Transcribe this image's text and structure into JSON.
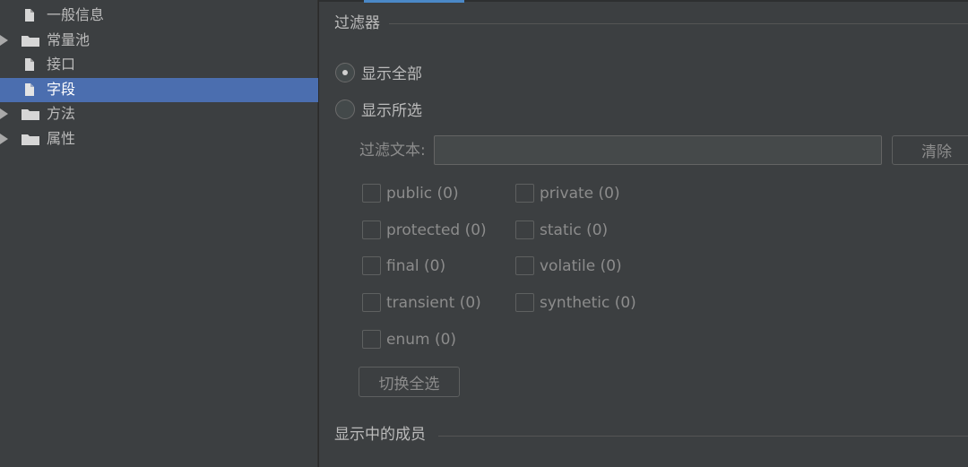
{
  "tree": {
    "items": [
      {
        "label": "一般信息",
        "icon": "file-icon",
        "expandable": false,
        "selected": false
      },
      {
        "label": "常量池",
        "icon": "folder-icon",
        "expandable": true,
        "selected": false
      },
      {
        "label": "接口",
        "icon": "file-icon",
        "expandable": false,
        "selected": false
      },
      {
        "label": "字段",
        "icon": "file-icon",
        "expandable": false,
        "selected": true
      },
      {
        "label": "方法",
        "icon": "folder-icon",
        "expandable": true,
        "selected": false
      },
      {
        "label": "属性",
        "icon": "folder-icon",
        "expandable": true,
        "selected": false
      }
    ]
  },
  "filter": {
    "title": "过滤器",
    "radio_all": "显示全部",
    "radio_selected": "显示所选",
    "radio_checked": "all",
    "text_label": "过滤文本:",
    "text_value": "",
    "clear_button": "清除",
    "checkboxes": [
      {
        "label": "public (0)",
        "checked": false
      },
      {
        "label": "private (0)",
        "checked": false
      },
      {
        "label": "protected (0)",
        "checked": false
      },
      {
        "label": "static (0)",
        "checked": false
      },
      {
        "label": "final (0)",
        "checked": false
      },
      {
        "label": "volatile (0)",
        "checked": false
      },
      {
        "label": "transient (0)",
        "checked": false
      },
      {
        "label": "synthetic (0)",
        "checked": false
      },
      {
        "label": "enum (0)",
        "checked": false
      }
    ],
    "toggle_button": "切换全选"
  },
  "members": {
    "title": "显示中的成员"
  },
  "colors": {
    "background": "#3c3f41",
    "selection": "#4b6eaf",
    "text": "#bbbbbb",
    "muted_text": "#8c8c8c",
    "accent": "#4a88c7"
  }
}
